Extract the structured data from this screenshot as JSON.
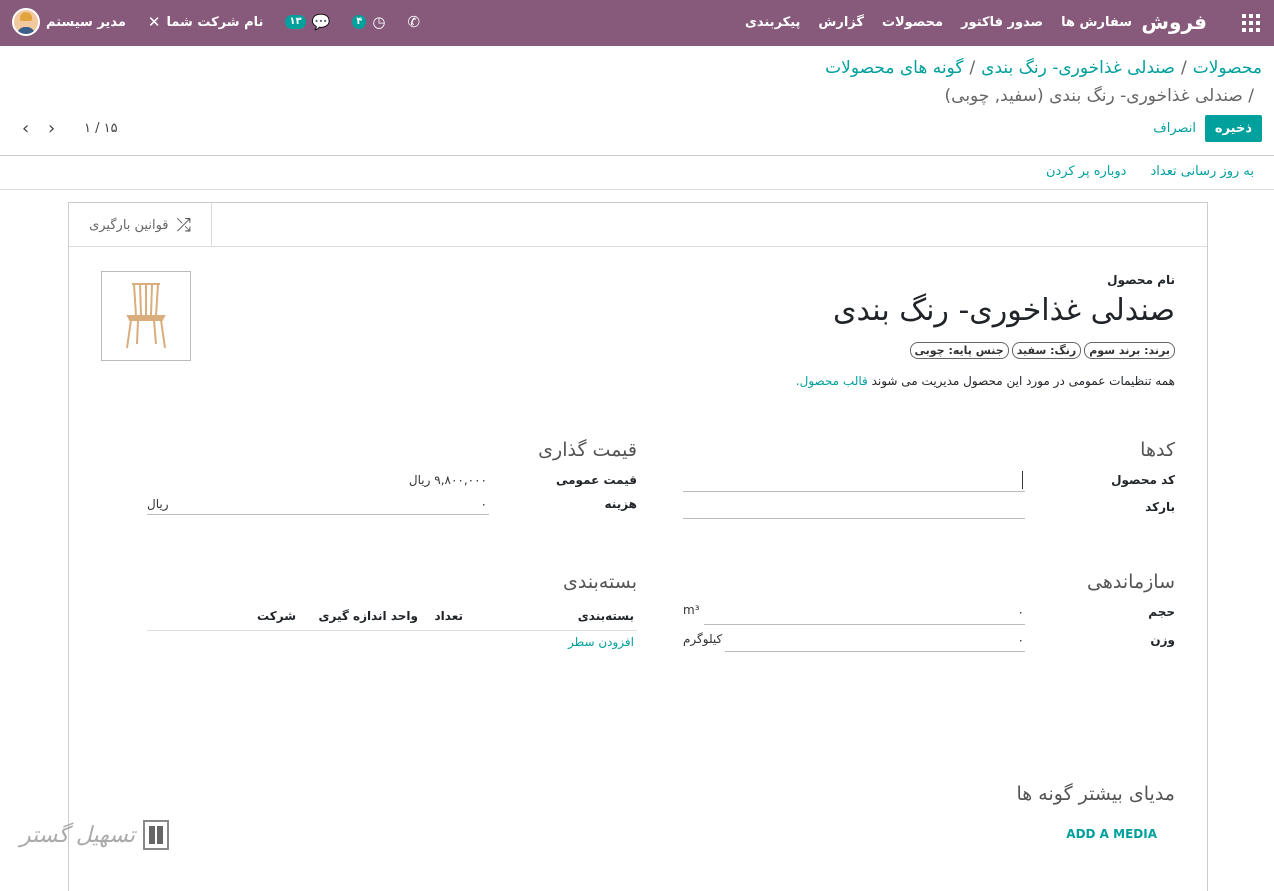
{
  "navbar": {
    "brand": "فروش",
    "menu": [
      "سفارش ها",
      "صدور فاکتور",
      "محصولات",
      "گزارش",
      "پیکربندی"
    ],
    "user_name": "مدیر سیستم",
    "company": "نام شرکت شما",
    "messages_count": "۱۳",
    "activities_count": "۴",
    "icons": [
      "apps-grid-icon",
      "phone-icon",
      "clock-icon",
      "chat-icon",
      "tools-icon"
    ]
  },
  "breadcrumb": {
    "items": [
      "محصولات",
      "صندلی غذاخوری- رنگ بندی",
      "گونه های محصولات"
    ],
    "current": "صندلی غذاخوری- رنگ بندی (سفید, چوبی)"
  },
  "actions": {
    "save": "ذخیره",
    "discard": "انصراف"
  },
  "pager": {
    "value": "۱ / ۱۵"
  },
  "statusbar": {
    "update_qty": "به روز رسانی تعداد",
    "replenish": "دوباره پر کردن"
  },
  "smart_button": {
    "label": "قوانین بارگیری"
  },
  "product": {
    "name_label": "نام محصول",
    "name": "صندلی غذاخوری- رنگ بندی",
    "tags": [
      "برند: برند سوم",
      "رنگ: سفید",
      "جنس پایه: چوبی"
    ],
    "template_note": "همه تنظیمات عمومی در مورد این محصول مدیریت می شوند",
    "template_link": "قالب محصول."
  },
  "codes": {
    "title": "کدها",
    "internal_ref_label": "کد محصول",
    "barcode_label": "بارکد"
  },
  "pricing": {
    "title": "قیمت گذاری",
    "sales_price_label": "قیمت عمومی",
    "sales_price": "۹,۸۰۰,۰۰۰ ریال",
    "cost_label": "هزینه",
    "cost": "۰",
    "cost_currency": "ریال"
  },
  "logistics": {
    "title": "سازماندهی",
    "volume_label": "حجم",
    "volume": "۰",
    "volume_unit": "m³",
    "weight_label": "وزن",
    "weight": "۰",
    "weight_unit": "کیلوگرم"
  },
  "packaging": {
    "title": "بسته‌بندی",
    "columns": [
      "بسته‌بندی",
      "تعداد",
      "واحد اندازه گیری",
      "شرکت"
    ],
    "add_line": "افزودن سطر"
  },
  "media": {
    "title": "مدیای بیشتر گونه ها",
    "add_button": "ADD A MEDIA"
  },
  "watermark": {
    "text": "تسهیل گستر"
  },
  "colors": {
    "navbar": "#875a7b",
    "accent": "#00a09d"
  }
}
